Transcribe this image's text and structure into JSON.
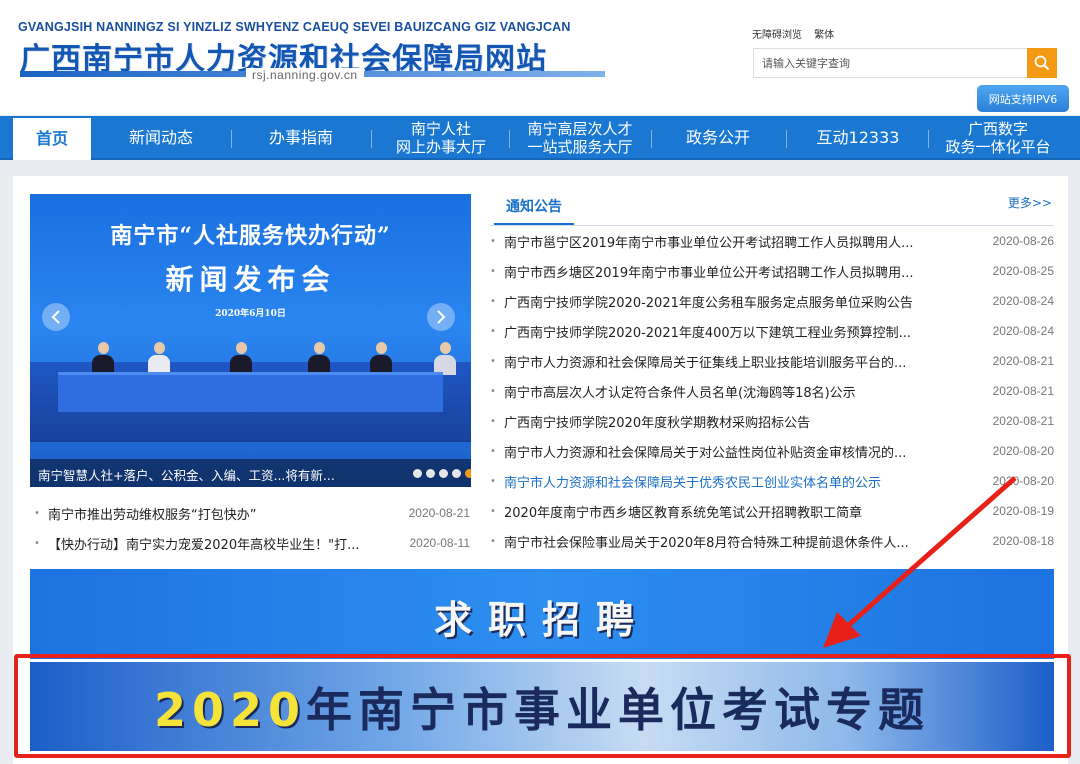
{
  "header": {
    "logo_subtitle": "GVANGJSIH NANNINGZ SI YINZLIZ SWHYENZ CAEUQ SEVEI BAUIZCANG GIZ VANGJCAN",
    "logo_title": "广西南宁市人力资源和社会保障局网站",
    "domain": "rsj.nanning.gov.cn",
    "accessibility_link": "无障碍浏览",
    "traditional_link": "繁体",
    "search_placeholder": "请输入关键字查询",
    "search_icon": "search-icon",
    "ipv6_badge": "网站支持IPV6",
    "accent_color": "#f39a12"
  },
  "nav": {
    "items": [
      {
        "label": "首页"
      },
      {
        "label": "新闻动态"
      },
      {
        "label": "办事指南"
      },
      {
        "line1": "南宁人社",
        "line2": "网上办事大厅"
      },
      {
        "line1": "南宁高层次人才",
        "line2": "一站式服务大厅"
      },
      {
        "label": "政务公开"
      },
      {
        "label": "互动12333"
      },
      {
        "line1": "广西数字",
        "line2": "政务一体化平台"
      }
    ],
    "color": "#1a78d2"
  },
  "slideshow": {
    "headline_line1": "南宁市“人社服务快办行动”",
    "headline_line2": "新闻发布会",
    "date": "2020年6月10日",
    "caption": "南宁智慧人社+落户、公积金、入编、工资...将有新...",
    "prev_icon": "chevron-left-icon",
    "next_icon": "chevron-right-icon",
    "dot_count": 5,
    "active_dot": 5
  },
  "left_news": [
    {
      "title": "南宁市推出劳动维权服务“打包快办”",
      "date": "2020-08-21"
    },
    {
      "title": "【快办行动】南宁实力宠爱2020年高校毕业生！\"打...",
      "date": "2020-08-11"
    }
  ],
  "notices": {
    "tab_label": "通知公告",
    "more_label": "更多>>",
    "items": [
      {
        "title": "南宁市邕宁区2019年南宁市事业单位公开考试招聘工作人员拟聘用人...",
        "date": "2020-08-26"
      },
      {
        "title": "南宁市西乡塘区2019年南宁市事业单位公开考试招聘工作人员拟聘用...",
        "date": "2020-08-25"
      },
      {
        "title": "广西南宁技师学院2020-2021年度公务租车服务定点服务单位采购公告",
        "date": "2020-08-24"
      },
      {
        "title": "广西南宁技师学院2020-2021年度400万以下建筑工程业务预算控制...",
        "date": "2020-08-24"
      },
      {
        "title": "南宁市人力资源和社会保障局关于征集线上职业技能培训服务平台的...",
        "date": "2020-08-21"
      },
      {
        "title": "南宁市高层次人才认定符合条件人员名单(沈海鸥等18名)公示",
        "date": "2020-08-21"
      },
      {
        "title": "广西南宁技师学院2020年度秋学期教材采购招标公告",
        "date": "2020-08-21"
      },
      {
        "title": "南宁市人力资源和社会保障局关于对公益性岗位补贴资金审核情况的...",
        "date": "2020-08-20"
      },
      {
        "title": "南宁市人力资源和社会保障局关于优秀农民工创业实体名单的公示",
        "date": "2020-08-20"
      },
      {
        "title": "2020年度南宁市西乡塘区教育系统免笔试公开招聘教职工简章",
        "date": "2020-08-19"
      },
      {
        "title": "南宁市社会保险事业局关于2020年8月符合特殊工种提前退休条件人...",
        "date": "2020-08-18"
      }
    ]
  },
  "banners": {
    "recruit": "求职招聘",
    "exam_year": "2020",
    "exam_title": "年南宁市事业单位考试专题",
    "highlight_color": "#e8201a"
  }
}
